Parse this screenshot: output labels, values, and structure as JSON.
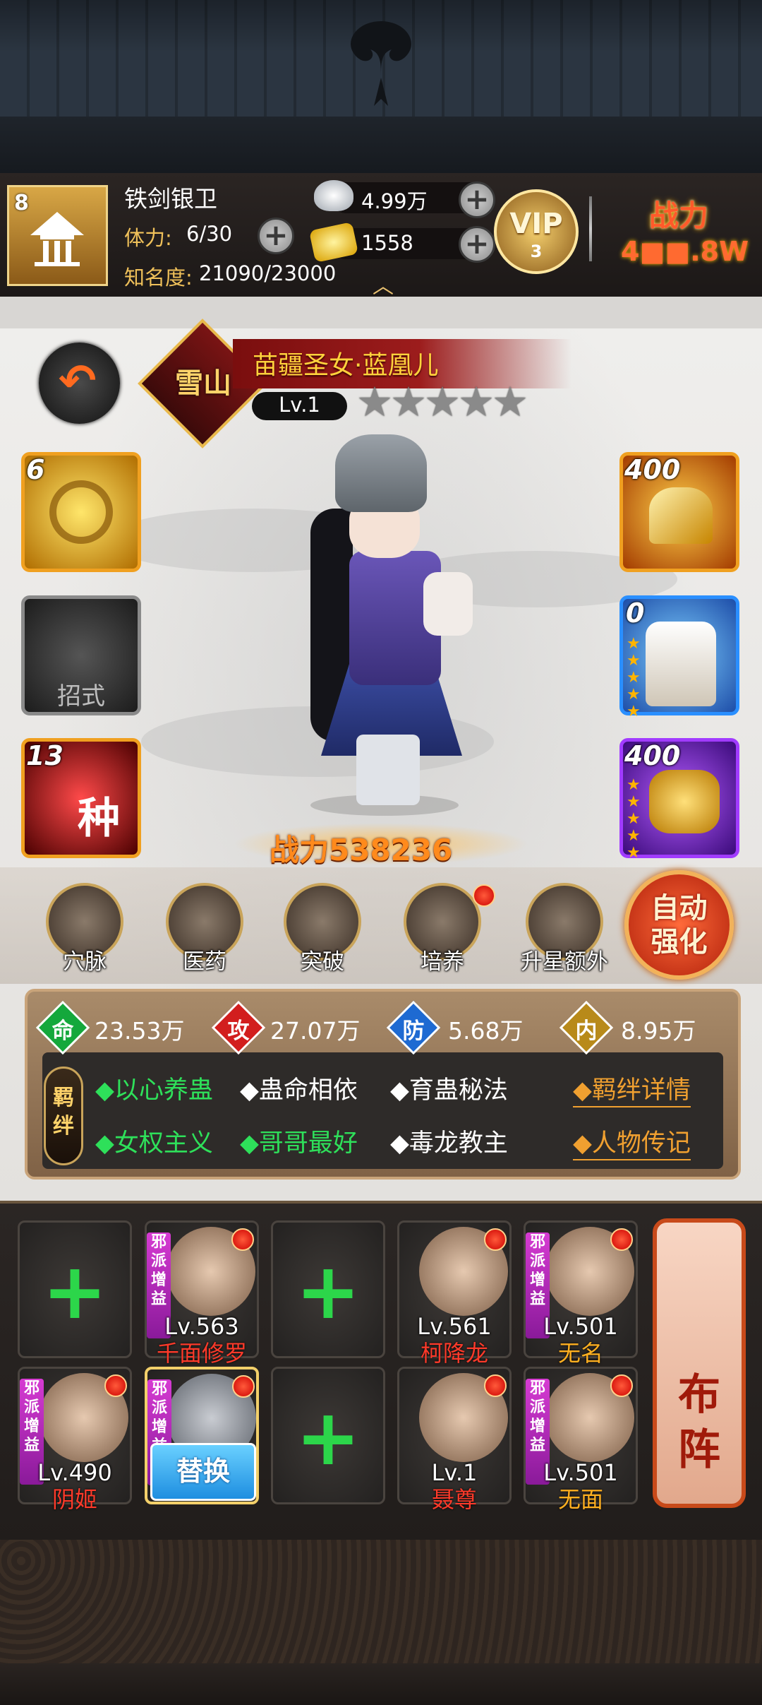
{
  "header": {
    "player_name": "铁剑银卫",
    "avatar_level": "8",
    "stamina_label": "体力:",
    "stamina_value": "6/30",
    "fame_label": "知名度:",
    "fame_value": "21090/23000",
    "silver": "4.99万",
    "gold": "1558",
    "vip_text": "VIP",
    "vip_level": "3",
    "power_label": "战力",
    "power_value": "4■■.8W",
    "plus_glyph": "+",
    "expand_glyph": "︿"
  },
  "hero": {
    "faction": "雪山",
    "name": "苗疆圣女·蓝凰儿",
    "level": "Lv.1",
    "stars_total": 5,
    "stars_filled": 0,
    "power": "战力538236",
    "back_glyph": "↶"
  },
  "skill_slots": [
    {
      "count": "6"
    },
    {
      "label": "招式"
    },
    {
      "count": "13",
      "glyph": "种"
    }
  ],
  "equip_slots": [
    {
      "count": "400"
    },
    {
      "count": "0",
      "stars": "★★★★★"
    },
    {
      "count": "400",
      "stars": "★★★★★"
    }
  ],
  "functions": [
    {
      "label": "穴脉",
      "icon": "meridian-icon"
    },
    {
      "label": "医药",
      "icon": "medicine-icon"
    },
    {
      "label": "突破",
      "icon": "breakthrough-icon"
    },
    {
      "label": "培养",
      "icon": "cultivate-icon",
      "notify": true
    },
    {
      "label": "升星额外",
      "icon": "star-up-icon"
    }
  ],
  "auto_enhance": "自动\n强化",
  "stats": {
    "hp": {
      "letter": "命",
      "value": "23.53万",
      "color": "#14a83c"
    },
    "atk": {
      "letter": "攻",
      "value": "27.07万",
      "color": "#d21e1e"
    },
    "def": {
      "letter": "防",
      "value": "5.68万",
      "color": "#1e6ad2"
    },
    "int": {
      "letter": "内",
      "value": "8.95万",
      "color": "#b88a1a"
    }
  },
  "bonds": {
    "tag": "羁\n绊",
    "items": [
      {
        "text": "◆以心养蛊",
        "active": true
      },
      {
        "text": "◆蛊命相依",
        "active": false
      },
      {
        "text": "◆育蛊秘法",
        "active": false
      },
      {
        "text": "◆女权主义",
        "active": true
      },
      {
        "text": "◆哥哥最好",
        "active": true
      },
      {
        "text": "◆毒龙教主",
        "active": false
      }
    ],
    "detail_link": "◆羁绊详情",
    "bio_link": "◆人物传记"
  },
  "roster": {
    "evil_tag": "邪派增益",
    "plus_glyph": "+",
    "replace_label": "替换",
    "formation_label": "布\n阵",
    "row1": [
      {
        "empty": true
      },
      {
        "level": "Lv.563",
        "name": "千面修罗",
        "evil": true
      },
      {
        "empty": true
      },
      {
        "level": "Lv.561",
        "name": "柯降龙",
        "evil": false
      },
      {
        "level": "Lv.501",
        "name": "无名",
        "evil": true
      }
    ],
    "row2": [
      {
        "level": "Lv.490",
        "name": "阴姬",
        "evil": true
      },
      {
        "selected": true,
        "evil": true
      },
      {
        "empty": true
      },
      {
        "level": "Lv.1",
        "name": "聂尊",
        "evil": false
      },
      {
        "level": "Lv.501",
        "name": "无面",
        "evil": true
      }
    ]
  }
}
